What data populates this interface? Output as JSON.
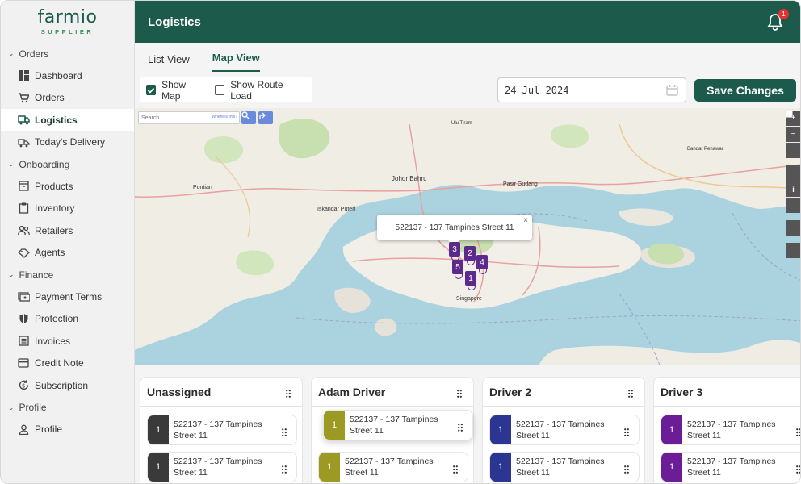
{
  "brand": {
    "name": "farmio",
    "sub": "SUPPLIER"
  },
  "header": {
    "title": "Logistics",
    "notif_count": "1"
  },
  "sidebar": {
    "sections": [
      {
        "label": "Orders",
        "items": [
          {
            "label": "Dashboard",
            "icon": "dashboard-icon"
          },
          {
            "label": "Orders",
            "icon": "cart-icon"
          },
          {
            "label": "Logistics",
            "icon": "truck-icon",
            "active": true
          },
          {
            "label": "Today's Delivery",
            "icon": "delivery-icon"
          }
        ]
      },
      {
        "label": "Onboarding",
        "items": [
          {
            "label": "Products",
            "icon": "box-icon"
          },
          {
            "label": "Inventory",
            "icon": "clipboard-icon"
          },
          {
            "label": "Retailers",
            "icon": "users-icon"
          },
          {
            "label": "Agents",
            "icon": "handshake-icon"
          }
        ]
      },
      {
        "label": "Finance",
        "items": [
          {
            "label": "Payment Terms",
            "icon": "money-icon"
          },
          {
            "label": "Protection",
            "icon": "shield-icon"
          },
          {
            "label": "Invoices",
            "icon": "invoice-icon"
          },
          {
            "label": "Credit Note",
            "icon": "card-icon"
          },
          {
            "label": "Subscription",
            "icon": "refresh-dollar-icon"
          }
        ]
      },
      {
        "label": "Profile",
        "items": [
          {
            "label": "Profile",
            "icon": "person-icon"
          }
        ]
      }
    ]
  },
  "tabs": [
    {
      "label": "List View"
    },
    {
      "label": "Map View",
      "active": true
    }
  ],
  "toolbar": {
    "show_map": "Show Map",
    "show_route_load": "Show Route Load",
    "date": "24 Jul 2024",
    "save_label": "Save Changes"
  },
  "map": {
    "search_placeholder": "Search",
    "where_label": "Where is this?",
    "popup_text": "522137 - 137 Tampines Street 11",
    "places": [
      "Johor Bahru",
      "Pasir Gudang",
      "Iskandar Puteri",
      "Pontian",
      "Singapore",
      "Ulu Tiram",
      "Bandar Penawar"
    ],
    "pins": [
      "3",
      "2",
      "5",
      "4",
      "1"
    ]
  },
  "board": {
    "columns": [
      {
        "title": "Unassigned",
        "color": "#3a3a3a",
        "cards": [
          {
            "num": "1",
            "text": "522137 - 137 Tampines Street 11"
          },
          {
            "num": "1",
            "text": "522137 - 137 Tampines Street 11"
          }
        ]
      },
      {
        "title": "Adam Driver",
        "color": "#9c9a23",
        "cards": [
          {
            "num": "1",
            "text": "522137 - 137 Tampines Street 11"
          },
          {
            "num": "1",
            "text": "522137 - 137 Tampines Street 11"
          }
        ]
      },
      {
        "title": "Driver 2",
        "color": "#2c3592",
        "cards": [
          {
            "num": "1",
            "text": "522137 - 137 Tampines Street 11"
          },
          {
            "num": "1",
            "text": "522137 - 137 Tampines Street 11"
          }
        ]
      },
      {
        "title": "Driver 3",
        "color": "#6a1d96",
        "cards": [
          {
            "num": "1",
            "text": "522137 - 137 Tampines Street 11"
          },
          {
            "num": "1",
            "text": "522137 - 137 Tampines Street 11"
          }
        ]
      }
    ]
  },
  "colors": {
    "brand": "#1c5a4b",
    "sea": "#aad3df",
    "land": "#f1efe9",
    "park": "#c8dfb0"
  }
}
